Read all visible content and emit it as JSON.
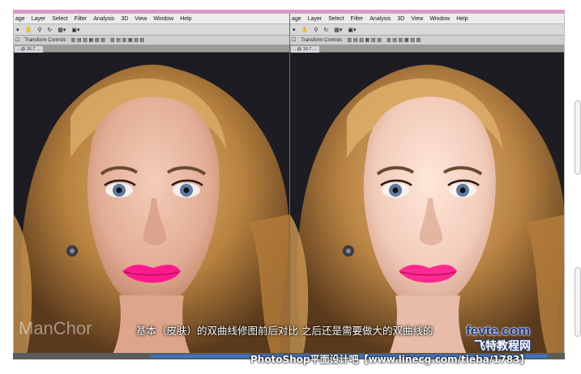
{
  "menu": [
    "age",
    "Layer",
    "Select",
    "Filter",
    "Analysis",
    "3D",
    "View",
    "Window",
    "Help"
  ],
  "options_bar": {
    "transform_controls": "Transform Controls"
  },
  "document_tab": "...@ 16.7 ...",
  "watermark": "ManChor",
  "subtitle": "基本（皮肤）的双曲线修图前后对比 之后还是需要做大的双曲线的",
  "credit": "PhotoShop平面设计吧【www.linecg.com/tieba/1783】",
  "logo": {
    "domain": "fevte.com",
    "name": "飞特教程网"
  },
  "colors": {
    "accent": "#c83aa0",
    "timeline": "#3b74c9",
    "logo_blue": "#1f3f8f",
    "lip": "#ff1a8c"
  }
}
